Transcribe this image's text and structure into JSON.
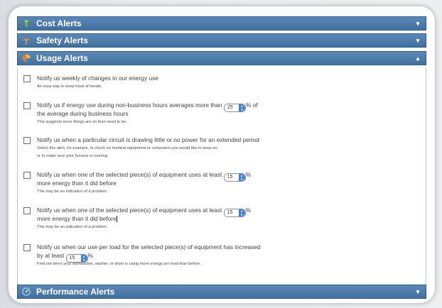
{
  "colors": {
    "bar": "#4a78a8",
    "cost_icon": "#6aa84f",
    "safety_icon": "#e08a3a",
    "usage_icon": "#e27d28",
    "performance_icon": "#9fc3e6"
  },
  "sections": {
    "cost": {
      "title": "Cost Alerts",
      "icon": "piggy-bank-icon",
      "state": "collapsed"
    },
    "safety": {
      "title": "Safety Alerts",
      "icon": "umbrella-icon",
      "state": "collapsed"
    },
    "usage": {
      "title": "Usage Alerts",
      "icon": "pie-chart-icon",
      "state": "expanded"
    },
    "performance": {
      "title": "Performance Alerts",
      "icon": "gauge-icon",
      "state": "collapsed"
    }
  },
  "alerts": [
    {
      "text": "Notify us weekly of changes in our energy use",
      "desc": "An easy way to keep track of trends."
    },
    {
      "text_a": "Notify us if energy use during non-business hours averages more than",
      "value": "25",
      "text_b": "% of",
      "text_c": "the average during business hours",
      "desc": "This suggests more things are on than need to be."
    },
    {
      "text": "Notify us when a particular circuit is drawing little or no power for an extended period",
      "desc": "Select this alert, for example, to check on medical equipment or computers you would like to keep on,",
      "desc2": "or to make sure your furnace is running."
    },
    {
      "text_a": "Notify us when one of the selected piece(s) of equipment uses at least",
      "value": "15",
      "text_b": "%",
      "text_c": "more energy than it did before",
      "desc": "This may be an indication of a problem."
    },
    {
      "text_a": "Notify us when one of the selected piece(s) of equipment uses at least",
      "value": "15",
      "text_b": "%",
      "text_c": "more energy than it did before",
      "desc": "This may be an indication of a problem."
    },
    {
      "text": "Notify us when our use per load for the selected piece(s) of equipment has increased",
      "text_c": "by at least",
      "value": "15",
      "text_b": "%",
      "desc": "Find out when your dishwasher, washer, or dryer is using more energy per load than before."
    }
  ]
}
